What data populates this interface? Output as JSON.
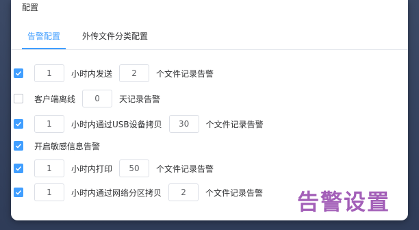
{
  "dialog": {
    "title": "配置",
    "tabs": [
      {
        "label": "告警配置"
      },
      {
        "label": "外传文件分类配置"
      }
    ]
  },
  "rows": [
    {
      "checked": true,
      "input1": "1",
      "text1": "小时内发送",
      "input2": "2",
      "text2": "个文件记录告警"
    },
    {
      "checked": false,
      "text1": "客户端离线",
      "input1": "0",
      "text2": "天记录告警"
    },
    {
      "checked": true,
      "input1": "1",
      "text1": "小时内通过USB设备拷贝",
      "input2": "30",
      "text2": "个文件记录告警"
    },
    {
      "checked": true,
      "text1": "开启敏感信息告警"
    },
    {
      "checked": true,
      "input1": "1",
      "text1": "小时内打印",
      "input2": "50",
      "text2": "个文件记录告警"
    },
    {
      "checked": true,
      "input1": "1",
      "text1": "小时内通过网络分区拷贝",
      "input2": "2",
      "text2": "个文件记录告警"
    }
  ],
  "watermark": "告警设置",
  "colors": {
    "accent": "#409eff",
    "watermark": "#a35fb8"
  }
}
